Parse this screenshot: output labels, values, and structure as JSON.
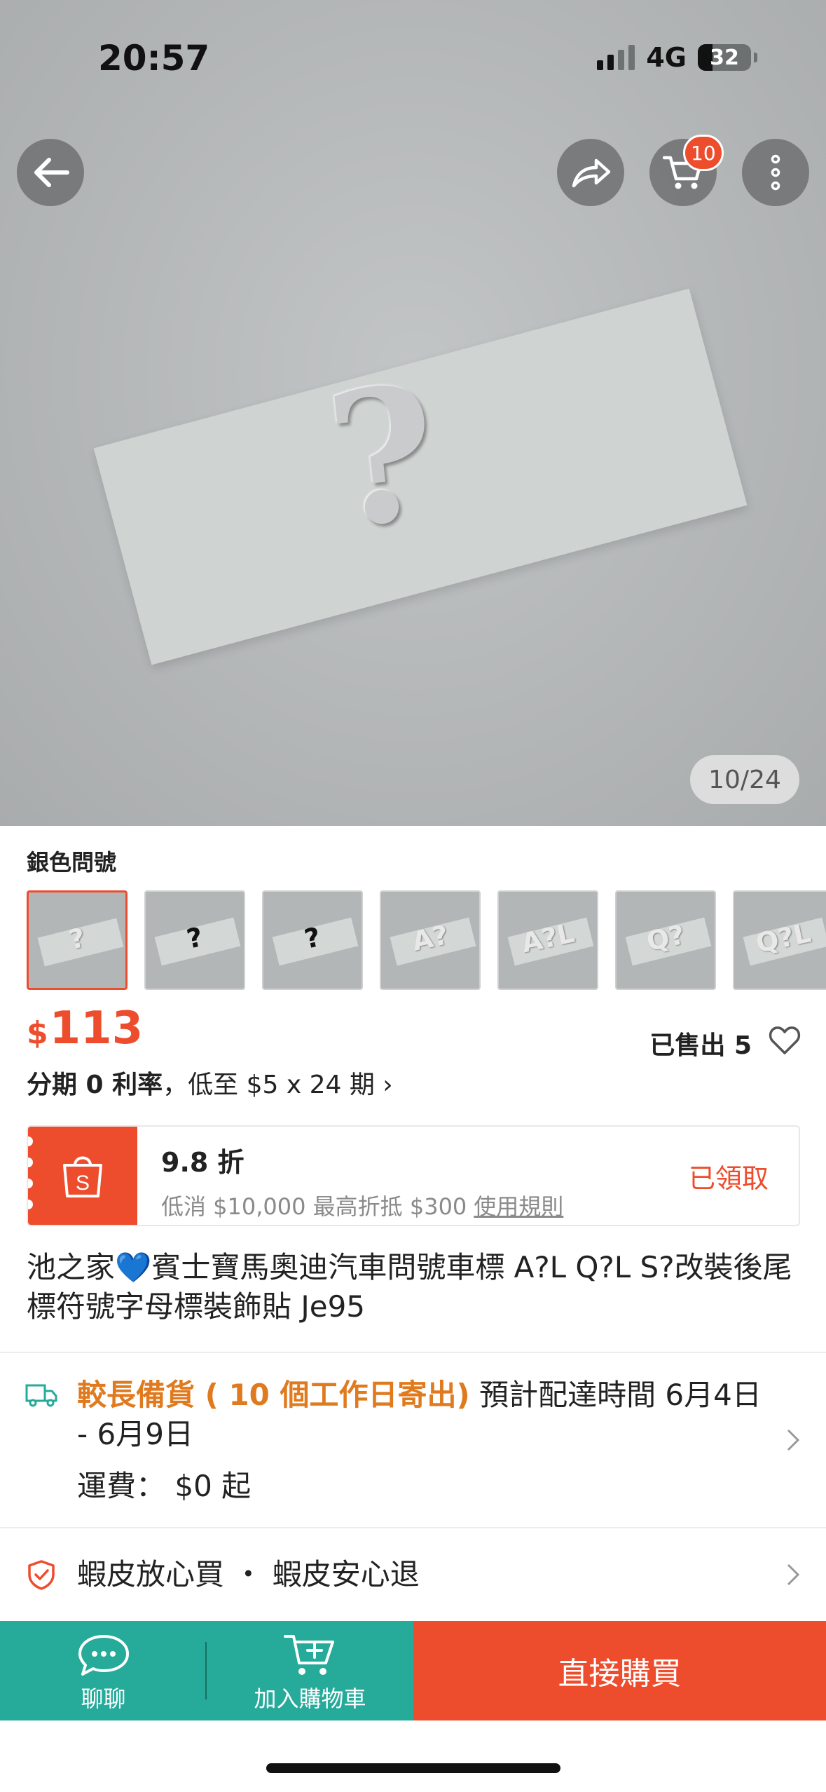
{
  "status_bar": {
    "time": "20:57",
    "network": "4G",
    "battery": "32"
  },
  "top_nav": {
    "cart_badge": "10"
  },
  "gallery": {
    "counter": "10/24",
    "image_subject": "?"
  },
  "variants": {
    "selected_label": "銀色問號",
    "thumbs": [
      {
        "glyph": "?",
        "style": "light"
      },
      {
        "glyph": "?",
        "style": "dark"
      },
      {
        "glyph": "?",
        "style": "dark"
      },
      {
        "glyph": "A?",
        "style": "light"
      },
      {
        "glyph": "A?L",
        "style": "light"
      },
      {
        "glyph": "Q?",
        "style": "light"
      },
      {
        "glyph": "Q?L",
        "style": "light"
      }
    ]
  },
  "price": {
    "currency": "$",
    "amount": "113",
    "sold": "已售出 5"
  },
  "installment": {
    "prefix": "分期 0 利率",
    "suffix": "，低至 $5 x 24 期 ›"
  },
  "voucher": {
    "discount": "9.8 折",
    "condition": "低消 $10,000 最高折抵 $300",
    "rule_link": "使用規則",
    "status": "已領取"
  },
  "product": {
    "title_pre": "池之家",
    "title_heart": "💙",
    "title_post": "賓士寶馬奧迪汽車問號車標 A?L Q?L S?改裝後尾標符號字母標裝飾貼 Je95"
  },
  "shipping": {
    "highlight": "較長備貨 ( 10 個工作日寄出)",
    "estimate": " 預計配達時間 6月4日 - 6月9日",
    "fee": "運費： $0 起"
  },
  "guarantee": {
    "text": "蝦皮放心買 ・ 蝦皮安心退"
  },
  "bottom_bar": {
    "chat": "聊聊",
    "add_cart": "加入購物車",
    "buy_now": "直接購買"
  },
  "colors": {
    "brand": "#ee4d2d",
    "teal": "#26aa99",
    "shipping_highlight": "#e07a1f"
  }
}
